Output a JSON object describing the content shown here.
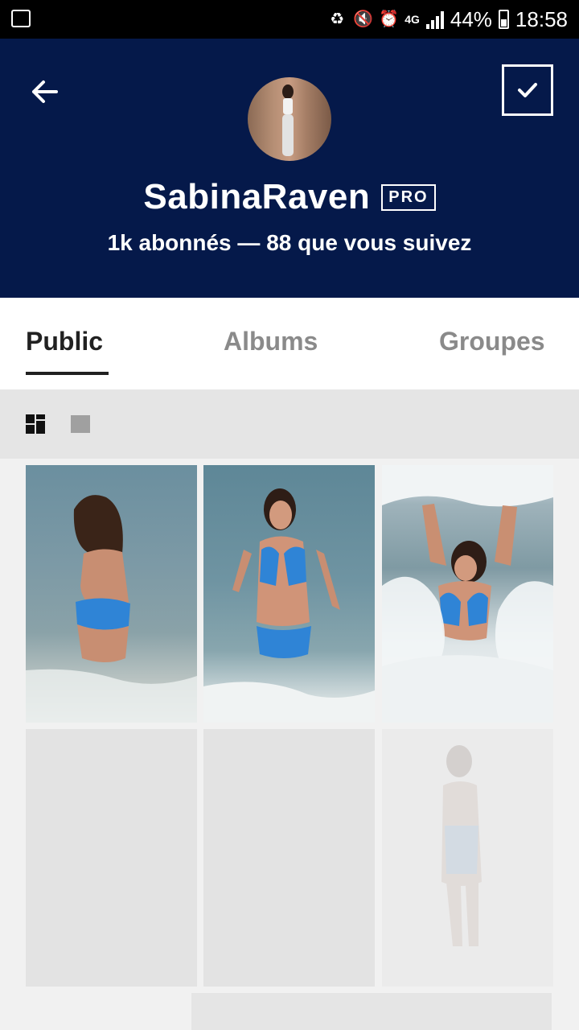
{
  "status_bar": {
    "battery": "44%",
    "time": "18:58",
    "network": "4G",
    "icons": [
      "gallery-icon",
      "battery-saver-icon",
      "mute-icon",
      "alarm-icon",
      "network-4g-icon",
      "signal-icon",
      "battery-icon"
    ]
  },
  "header": {
    "username": "SabinaRaven",
    "badge": "PRO",
    "stats": "1k abonnés — 88 que vous suivez",
    "background": "#05194a"
  },
  "tabs": [
    {
      "label": "Public",
      "active": true
    },
    {
      "label": "Albums",
      "active": false
    },
    {
      "label": "Groupes",
      "active": false
    }
  ],
  "view_toggle": {
    "icons": [
      "grid-view-icon",
      "single-view-icon"
    ],
    "selected": "grid-view-icon"
  },
  "photos": [
    {
      "name": "photo-1",
      "loaded": true
    },
    {
      "name": "photo-2",
      "loaded": true
    },
    {
      "name": "photo-3",
      "loaded": true
    },
    {
      "name": "photo-4",
      "loaded": false
    },
    {
      "name": "photo-5",
      "loaded": false
    },
    {
      "name": "photo-6",
      "loaded": false
    },
    {
      "name": "photo-7",
      "loaded": false
    }
  ]
}
